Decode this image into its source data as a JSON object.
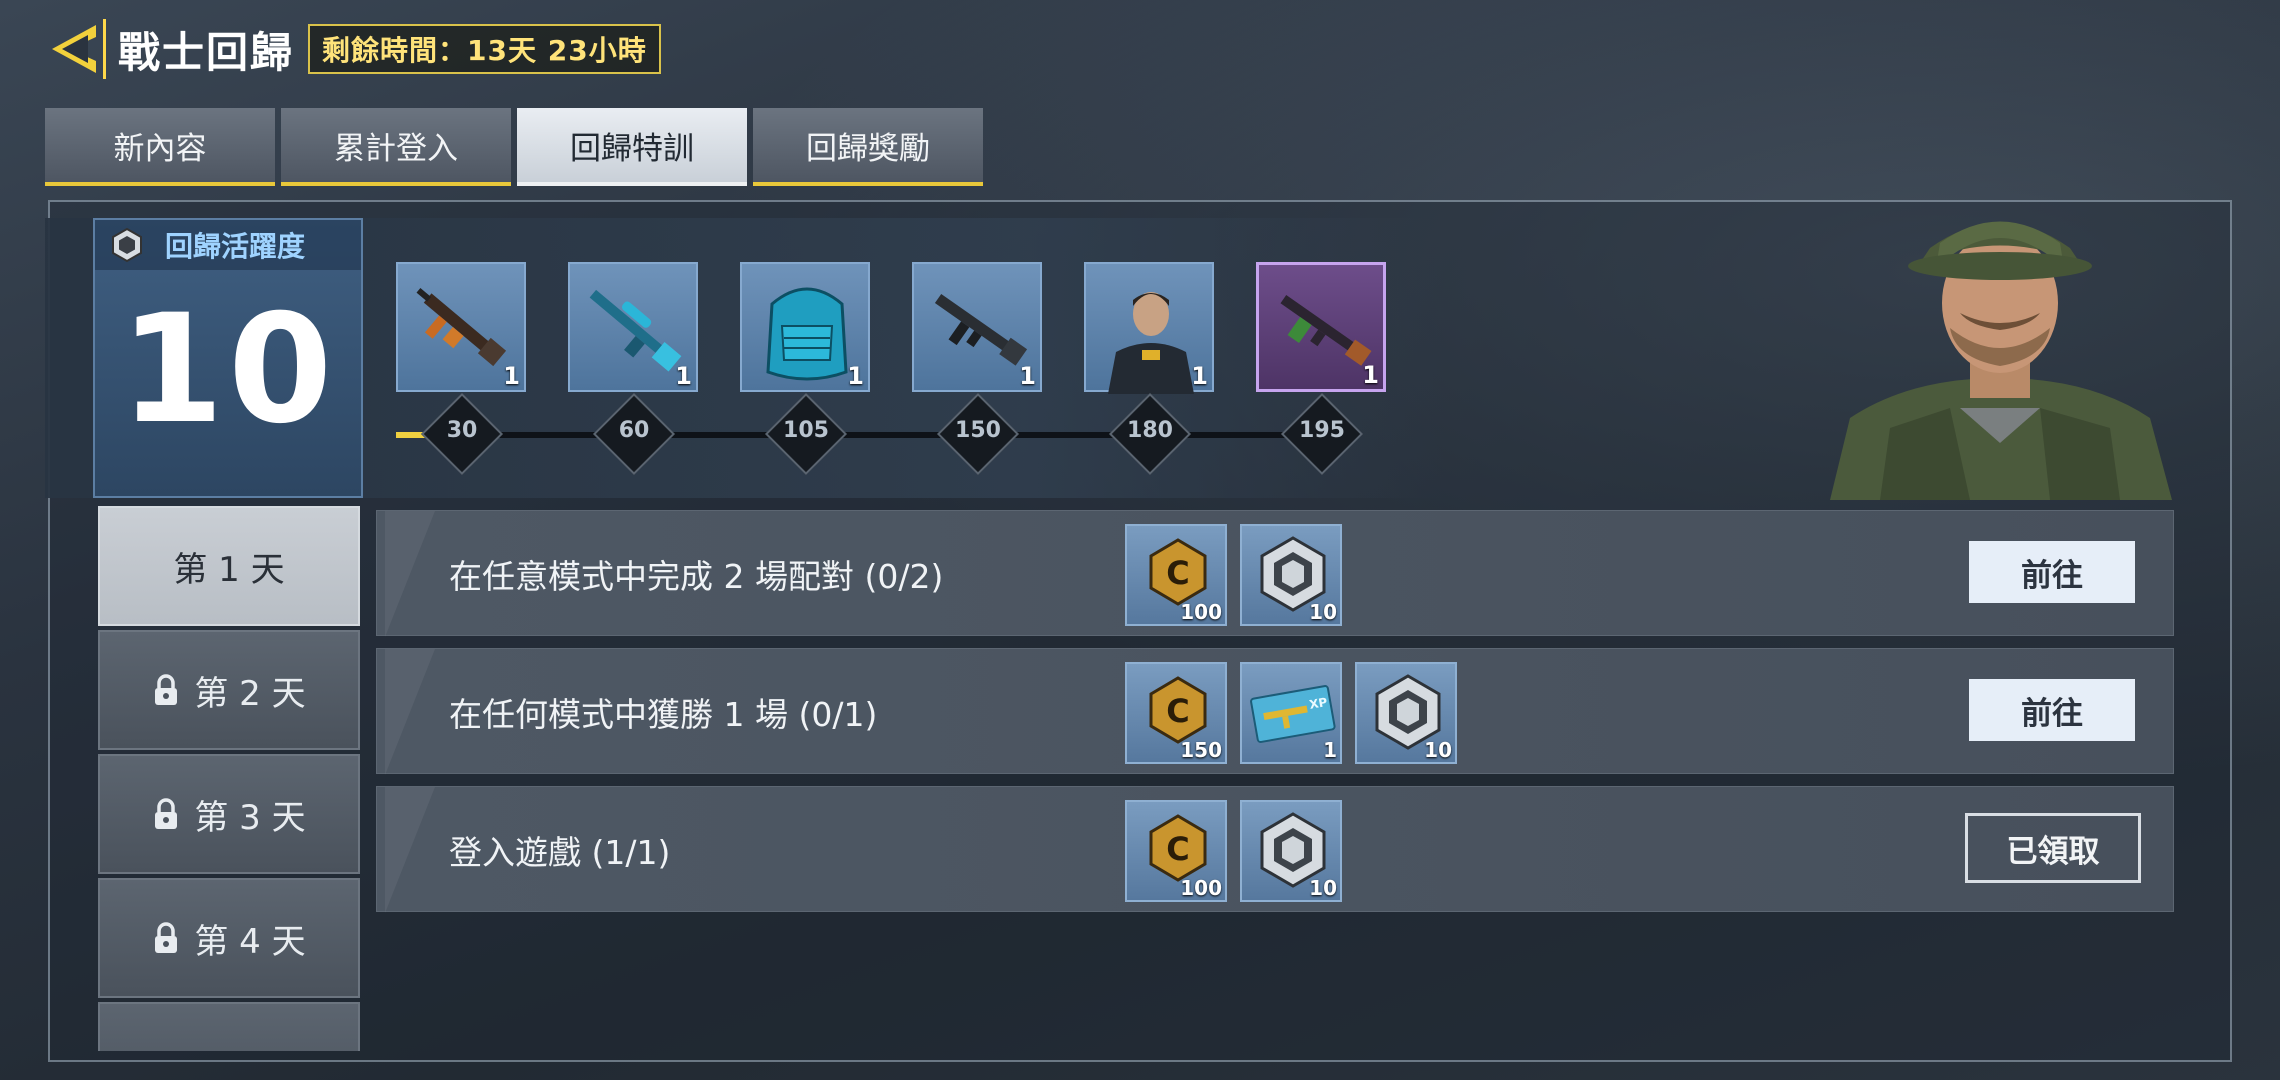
{
  "header": {
    "title": "戰士回歸",
    "timer": "剩餘時間：13天 23小時"
  },
  "tabs": [
    {
      "label": "新內容",
      "active": false
    },
    {
      "label": "累計登入",
      "active": false
    },
    {
      "label": "回歸特訓",
      "active": true
    },
    {
      "label": "回歸獎勵",
      "active": false
    }
  ],
  "activity": {
    "label": "回歸活躍度",
    "value": "10",
    "progress_fraction": 0.05
  },
  "milestones": [
    {
      "points": "30",
      "reward": "rifle-icon",
      "count": "1",
      "rarity": "blue"
    },
    {
      "points": "60",
      "reward": "sniper-rifle-icon",
      "count": "1",
      "rarity": "blue"
    },
    {
      "points": "105",
      "reward": "backpack-icon",
      "count": "1",
      "rarity": "blue"
    },
    {
      "points": "150",
      "reward": "assault-rifle-icon",
      "count": "1",
      "rarity": "blue"
    },
    {
      "points": "180",
      "reward": "operator-icon",
      "count": "1",
      "rarity": "blue"
    },
    {
      "points": "195",
      "reward": "ak-rifle-icon",
      "count": "1",
      "rarity": "purple"
    }
  ],
  "days": [
    {
      "label": "第 1 天",
      "locked": false,
      "active": true
    },
    {
      "label": "第 2 天",
      "locked": true,
      "active": false
    },
    {
      "label": "第 3 天",
      "locked": true,
      "active": false
    },
    {
      "label": "第 4 天",
      "locked": true,
      "active": false
    }
  ],
  "tasks": [
    {
      "text": "在任意模式中完成 2 場配對 (0/2)",
      "rewards": [
        {
          "icon": "cod-points-icon",
          "count": "100"
        },
        {
          "icon": "activity-badge-icon",
          "count": "10"
        }
      ],
      "button": "前往",
      "claimed": false
    },
    {
      "text": "在任何模式中獲勝 1 場 (0/1)",
      "rewards": [
        {
          "icon": "cod-points-icon",
          "count": "150"
        },
        {
          "icon": "weapon-xp-card-icon",
          "count": "1"
        },
        {
          "icon": "activity-badge-icon",
          "count": "10"
        }
      ],
      "button": "前往",
      "claimed": false
    },
    {
      "text": "登入遊戲 (1/1)",
      "rewards": [
        {
          "icon": "cod-points-icon",
          "count": "100"
        },
        {
          "icon": "activity-badge-icon",
          "count": "10"
        }
      ],
      "button": "已領取",
      "claimed": true
    }
  ],
  "colors": {
    "accent": "#e9c83a",
    "score_blue": "#3f5f82",
    "purple_rarity": "#c6a4ee"
  }
}
